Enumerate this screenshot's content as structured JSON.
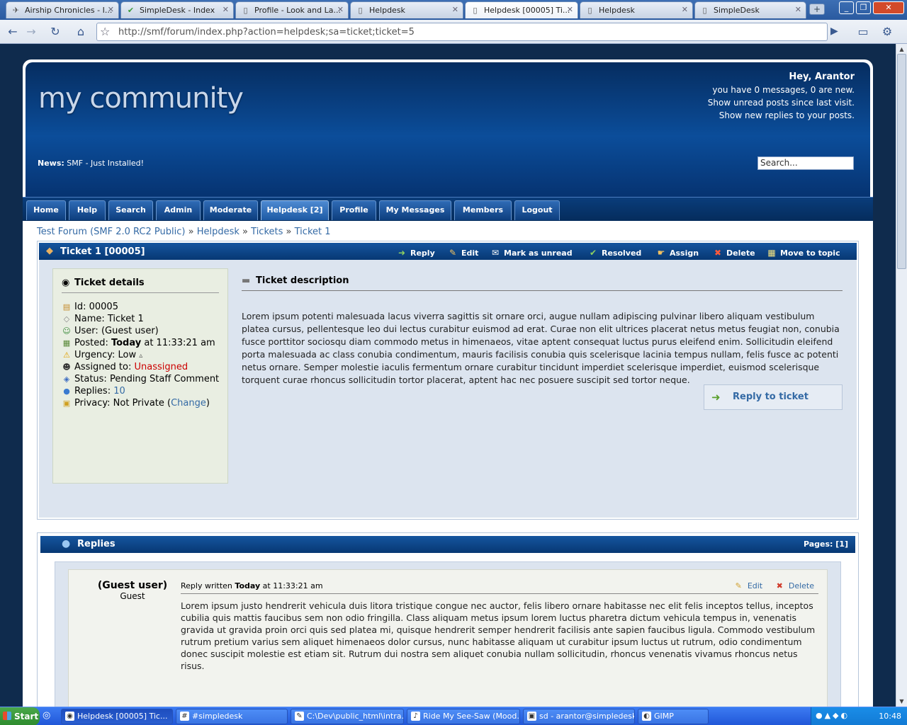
{
  "browser": {
    "tabs": [
      {
        "label": "Airship Chronicles - I...",
        "icon": "airship-icon"
      },
      {
        "label": "SimpleDesk - Index",
        "icon": "check-icon"
      },
      {
        "label": "Profile - Look and La...",
        "icon": "page-icon"
      },
      {
        "label": "Helpdesk",
        "icon": "page-icon"
      },
      {
        "label": "Helpdesk [00005] Ti...",
        "icon": "page-icon"
      },
      {
        "label": "Helpdesk",
        "icon": "page-icon"
      },
      {
        "label": "SimpleDesk",
        "icon": "page-icon"
      }
    ],
    "active_tab": 4,
    "url": "http://smf/forum/index.php?action=helpdesk;sa=ticket;ticket=5"
  },
  "header": {
    "logo": "my community",
    "greeting": "Hey, Arantor",
    "messages": "you have 0 messages, 0 are new.",
    "unread_link": "Show unread posts since last visit.",
    "replies_link": "Show new replies to your posts.",
    "news_label": "News:",
    "news_text": "SMF - Just Installed!",
    "search_value": "Search..."
  },
  "menu": {
    "items": [
      "Home",
      "Help",
      "Search",
      "Admin",
      "Moderate",
      "Helpdesk [2]",
      "Profile",
      "My Messages",
      "Members",
      "Logout"
    ],
    "active": "Helpdesk [2]"
  },
  "breadcrumb": {
    "items": [
      "Test Forum (SMF 2.0 RC2 Public)",
      "Helpdesk",
      "Tickets",
      "Ticket 1"
    ],
    "separator": "»"
  },
  "ticket": {
    "title": "Ticket 1 [00005]",
    "actions": [
      "Reply",
      "Edit",
      "Mark as unread",
      "Resolved",
      "Assign",
      "Delete",
      "Move to topic"
    ],
    "details_title": "Ticket details",
    "details": {
      "id_label": "Id:",
      "id": "00005",
      "name_label": "Name:",
      "name": "Ticket 1",
      "user_label": "User:",
      "user": "(Guest user)",
      "posted_label": "Posted:",
      "posted_day": "Today",
      "posted_time": "at 11:33:21 am",
      "urgency_label": "Urgency:",
      "urgency": "Low",
      "assigned_label": "Assigned to:",
      "assigned": "Unassigned",
      "status_label": "Status:",
      "status": "Pending Staff Comment",
      "replies_label": "Replies:",
      "replies": "10",
      "privacy_label": "Privacy:",
      "privacy": "Not Private",
      "privacy_change": "Change"
    },
    "description_title": "Ticket description",
    "description": "Lorem ipsum potenti malesuada lacus viverra sagittis sit ornare orci, augue nullam adipiscing pulvinar libero aliquam vestibulum platea cursus, pellentesque leo dui lectus curabitur euismod ad erat. Curae non elit ultrices placerat netus metus feugiat non, conubia fusce porttitor sociosqu diam commodo metus in himenaeos, vitae aptent consequat luctus purus eleifend enim. Sollicitudin eleifend porta malesuada ac class conubia condimentum, mauris facilisis conubia quis scelerisque lacinia tempus nullam, felis fusce ac potenti netus ornare. Semper molestie iaculis fermentum ornare curabitur tincidunt imperdiet scelerisque imperdiet, euismod scelerisque torquent curae rhoncus sollicitudin tortor placerat, aptent hac nec posuere suscipit sed tortor neque.",
    "reply_button": "Reply to ticket"
  },
  "replies": {
    "title": "Replies",
    "pages_label": "Pages:",
    "pages_value": "[1]",
    "items": [
      {
        "author": "(Guest user)",
        "role": "Guest",
        "meta_prefix": "Reply written",
        "meta_day": "Today",
        "meta_time": "at 11:33:21 am",
        "edit": "Edit",
        "delete": "Delete",
        "text": "Lorem ipsum justo hendrerit vehicula duis litora tristique congue nec auctor, felis libero ornare habitasse nec elit felis inceptos tellus, inceptos cubilia quis mattis faucibus sem non odio fringilla. Class aliquam metus ipsum lorem luctus pharetra dictum vehicula tempus in, venenatis gravida ut gravida proin orci quis sed platea mi, quisque hendrerit semper hendrerit facilisis ante sapien faucibus ligula. Commodo vestibulum rutrum pretium varius sem aliquet himenaeos dolor cursus, nunc habitasse aliquam ut curabitur ipsum luctus ut rutrum, odio condimentum donec suscipit molestie est etiam sit. Rutrum dui nostra sem aliquet conubia nullam sollicitudin, rhoncus venenatis vivamus rhoncus netus risus."
      }
    ]
  },
  "taskbar": {
    "start": "Start",
    "items": [
      "Helpdesk [00005] Tic...",
      "#simpledesk",
      "C:\\Dev\\public_html\\intra...",
      "Ride My See-Saw (Mood...",
      "sd - arantor@simpledesk...",
      "GIMP"
    ],
    "clock": "10:48"
  },
  "colors": {
    "header_dark": "#062d60",
    "header_mid": "#0b4d9a",
    "link": "#346aa5",
    "unassigned": "#cc0000",
    "panel_bg": "#dce4ef"
  }
}
